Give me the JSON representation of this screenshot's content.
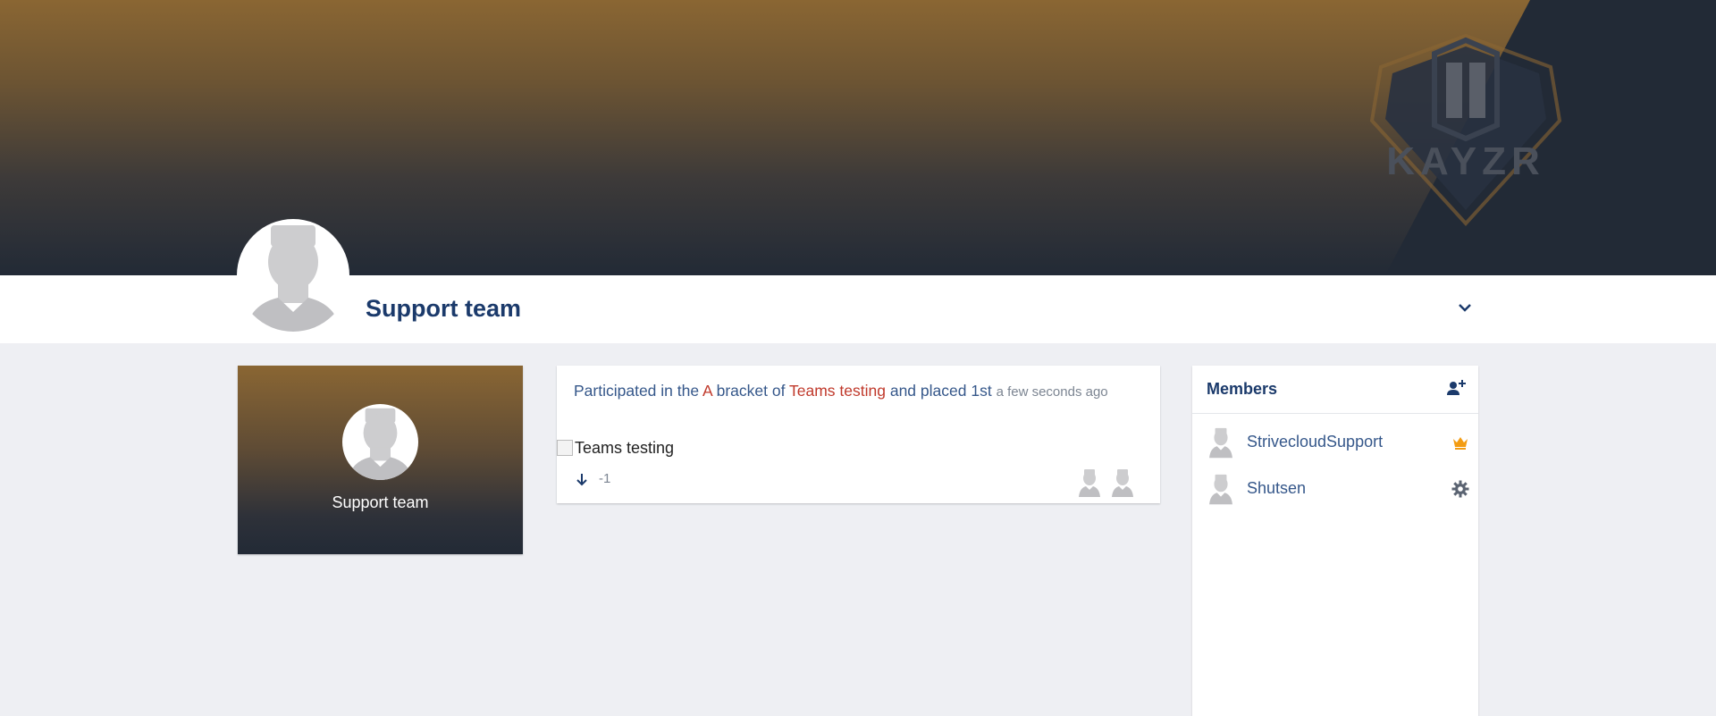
{
  "team": {
    "name": "Support team"
  },
  "banner": {
    "logo_text": "KAYZR"
  },
  "activity": {
    "prefix": "Participated in the",
    "bracket": "A",
    "middle": "bracket of",
    "tournament": "Teams testing",
    "suffix": "and placed 1st",
    "time": "a few seconds ago",
    "image_alt": "Teams testing",
    "vote_count": "-1"
  },
  "members": {
    "title": "Members",
    "list": [
      {
        "name": "StrivecloudSupport",
        "role_icon": "crown-icon"
      },
      {
        "name": "Shutsen",
        "role_icon": "gear-icon"
      }
    ]
  },
  "colors": {
    "brand_blue": "#1b3a6b",
    "link_blue": "#35578a",
    "accent_red": "#c0392b",
    "crown_orange": "#f39c12",
    "banner_top": "#8a6633",
    "banner_bottom": "#222a36"
  }
}
